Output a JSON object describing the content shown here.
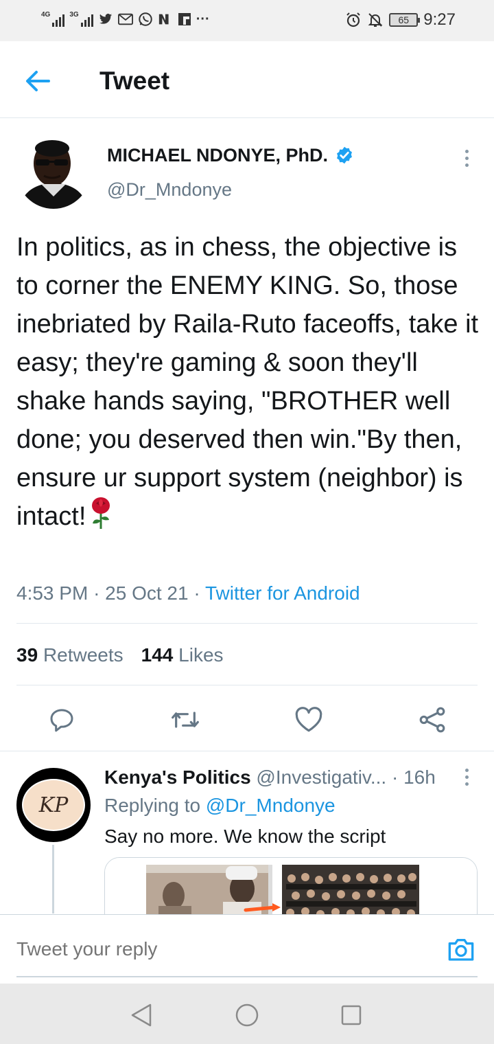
{
  "status_bar": {
    "network_1": "4G",
    "network_2": "3G",
    "battery": "65",
    "time": "9:27",
    "notification_icons": [
      "twitter-icon",
      "gmail-icon",
      "whatsapp-icon",
      "nation-icon",
      "flipboard-icon",
      "more-icon"
    ],
    "system_icons": [
      "alarm-icon",
      "mute-icon"
    ]
  },
  "header": {
    "title": "Tweet"
  },
  "tweet": {
    "author_name": "MICHAEL NDONYE, PhD.",
    "verified": true,
    "handle": "@Dr_Mndonye",
    "text": "In politics, as in chess, the objective is to corner the ENEMY KING. So, those inebriated by Raila-Ruto faceoffs, take it easy; they're gaming & soon they'll shake hands saying, \"BROTHER well done; you deserved then win.\"By then, ensure ur support system (neighbor) is intact!",
    "emoji": "rose",
    "time": "4:53 PM",
    "date": "25 Oct 21",
    "source": "Twitter for Android",
    "retweets_count": "39",
    "retweets_label": "Retweets",
    "likes_count": "144",
    "likes_label": "Likes"
  },
  "reply": {
    "author_name": "Kenya's Politics",
    "handle": "@Investigativ...",
    "time": "16h",
    "replying_to_label": "Replying to",
    "replying_to_handle": "@Dr_Mndonye",
    "text": "Say no more. We know the script",
    "avatar_text": "KP"
  },
  "composer": {
    "placeholder": "Tweet your reply"
  },
  "colors": {
    "twitter_blue": "#1da1f2",
    "link_blue": "#1b95e0",
    "secondary_text": "#657786",
    "primary_text": "#14171a",
    "rose_red": "#c8102e"
  }
}
